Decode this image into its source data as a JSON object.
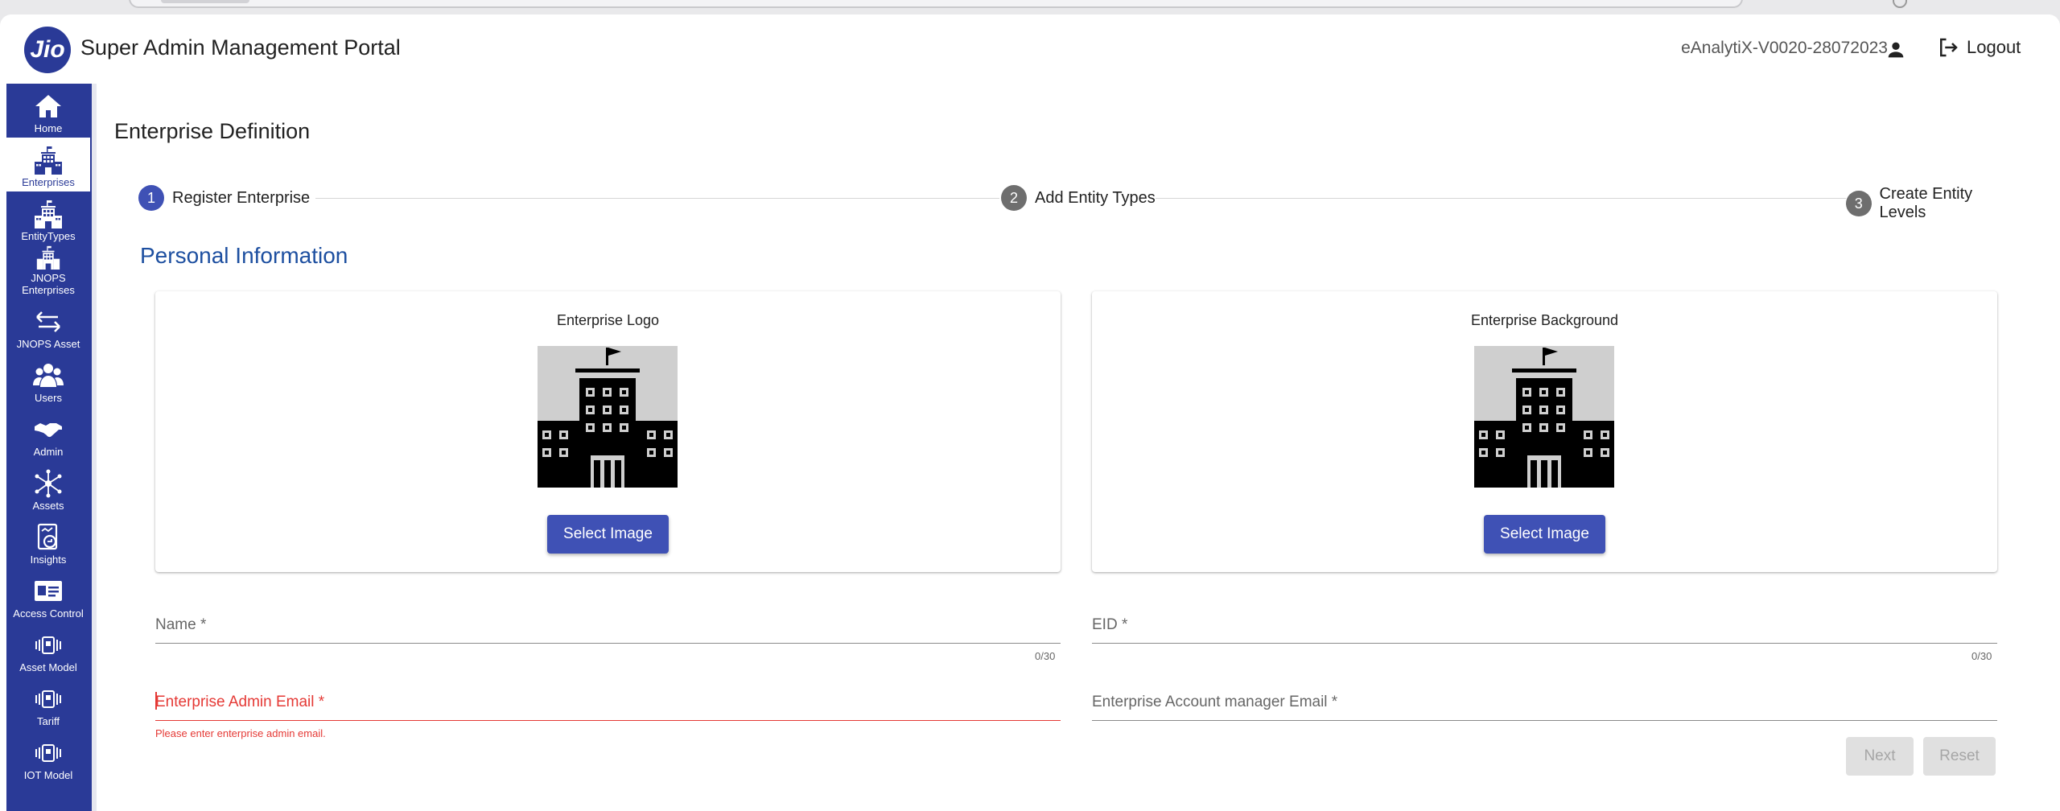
{
  "header": {
    "logo_text": "Jio",
    "title": "Super Admin Management Portal",
    "user_id": "eAnalytiX-V0020-28072023",
    "logout_label": "Logout"
  },
  "sidebar": {
    "items": [
      {
        "label": "Home",
        "icon": "home-icon"
      },
      {
        "label": "Enterprises",
        "icon": "building-icon",
        "active": true
      },
      {
        "label": "EntityTypes",
        "icon": "building-icon"
      },
      {
        "label": "JNOPS Enterprises",
        "icon": "building-icon"
      },
      {
        "label": "JNOPS Asset",
        "icon": "swap-arrows-icon"
      },
      {
        "label": "Users",
        "icon": "users-icon"
      },
      {
        "label": "Admin",
        "icon": "handshake-icon"
      },
      {
        "label": "Assets",
        "icon": "network-icon"
      },
      {
        "label": "Insights",
        "icon": "insights-icon"
      },
      {
        "label": "Access Control",
        "icon": "id-card-icon"
      },
      {
        "label": "Asset Model",
        "icon": "device-icon"
      },
      {
        "label": "Tariff",
        "icon": "device-icon"
      },
      {
        "label": "IOT Model",
        "icon": "device-icon"
      }
    ]
  },
  "page": {
    "title": "Enterprise Definition",
    "section_title": "Personal Information"
  },
  "stepper": {
    "steps": [
      {
        "num": "1",
        "label": "Register Enterprise",
        "active": true
      },
      {
        "num": "2",
        "label": "Add Entity Types",
        "active": false
      },
      {
        "num": "3",
        "label": "Create Entity Levels",
        "active": false
      }
    ]
  },
  "images": {
    "logo_label": "Enterprise Logo",
    "background_label": "Enterprise Background",
    "select_label": "Select Image"
  },
  "form": {
    "name_label": "Name *",
    "name_value": "",
    "name_counter": "0/30",
    "eid_label": "EID *",
    "eid_value": "",
    "eid_counter": "0/30",
    "admin_email_label": "Enterprise Admin Email *",
    "admin_email_error": "Please enter enterprise admin email.",
    "manager_email_label": "Enterprise Account manager Email *"
  },
  "actions": {
    "next_label": "Next",
    "reset_label": "Reset"
  },
  "colors": {
    "primary": "#3f51b5",
    "sidebar": "#2a3a97",
    "error": "#e53935",
    "section_title": "#1d4fa0"
  }
}
